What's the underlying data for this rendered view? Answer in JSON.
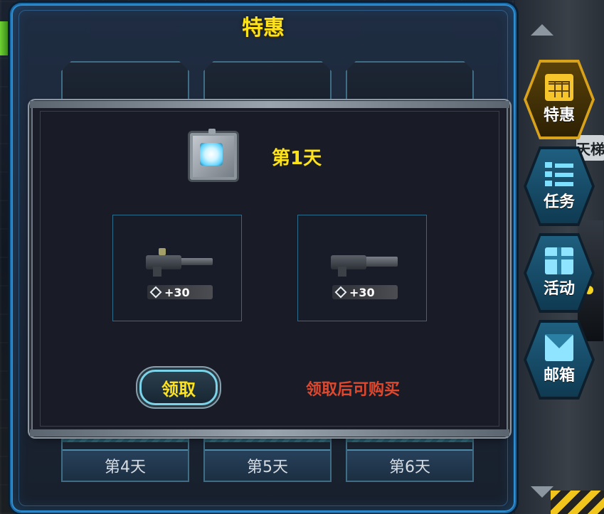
{
  "header": {
    "title": "特惠"
  },
  "day_cards": {
    "bottom": [
      "第4天",
      "第5天",
      "第6天"
    ]
  },
  "modal": {
    "day_label": "第1天",
    "rewards": [
      {
        "icon": "machine-gun",
        "amount": "+30"
      },
      {
        "icon": "minigun",
        "amount": "+30"
      }
    ],
    "claim_label": "领取",
    "note": "领取后可购买"
  },
  "sidebar": {
    "sign_text": "天梯",
    "items": [
      {
        "label": "特惠",
        "icon": "calendar-icon",
        "active": true
      },
      {
        "label": "任务",
        "icon": "task-list-icon",
        "active": false
      },
      {
        "label": "活动",
        "icon": "gift-icon",
        "active": false
      },
      {
        "label": "邮箱",
        "icon": "mail-icon",
        "active": false
      }
    ]
  },
  "colors": {
    "title_yellow": "#ffe31a",
    "note_red": "#e0482e",
    "active_gold": "#d9a21b",
    "panel_blue": "#1c6aa6"
  }
}
